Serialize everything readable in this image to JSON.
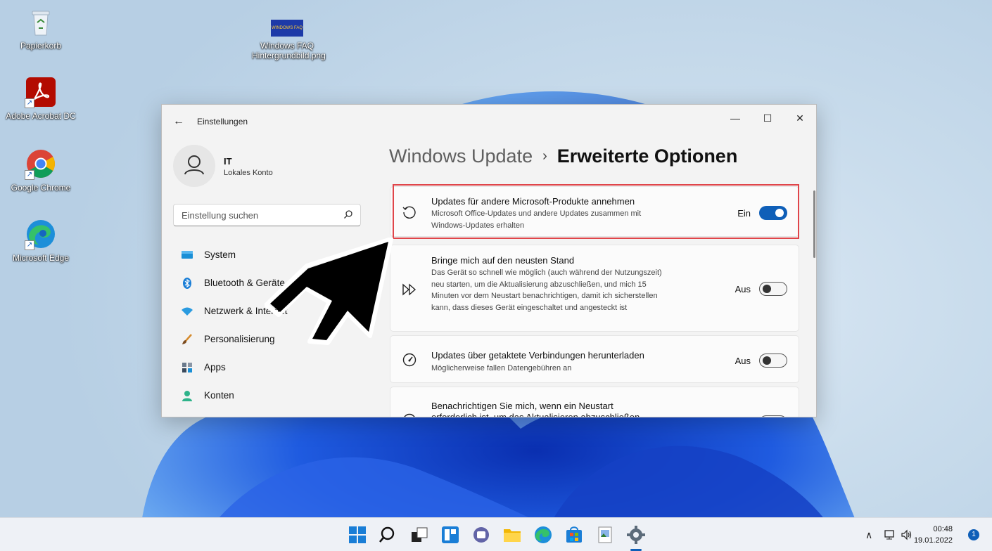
{
  "desktop": {
    "icons": [
      {
        "label": "Papierkorb"
      },
      {
        "label": "Windows FAQ Hintergrundbild.png"
      },
      {
        "label": "Adobe Acrobat DC"
      },
      {
        "label": "Google Chrome"
      },
      {
        "label": "Microsoft Edge"
      }
    ],
    "wallpaper_thumb_text": "WINDOWS FAQ"
  },
  "window": {
    "title": "Einstellungen",
    "user": {
      "name": "IT",
      "account": "Lokales Konto"
    },
    "search": {
      "placeholder": "Einstellung suchen"
    },
    "nav": [
      {
        "label": "System",
        "icon": "monitor-icon"
      },
      {
        "label": "Bluetooth & Geräte",
        "icon": "bluetooth-icon"
      },
      {
        "label": "Netzwerk & Internet",
        "icon": "wifi-icon"
      },
      {
        "label": "Personalisierung",
        "icon": "brush-icon"
      },
      {
        "label": "Apps",
        "icon": "apps-icon"
      },
      {
        "label": "Konten",
        "icon": "person-icon"
      }
    ],
    "breadcrumb": {
      "parent": "Windows Update",
      "separator": "›",
      "current": "Erweiterte Optionen"
    },
    "options": [
      {
        "title": "Updates für andere Microsoft-Produkte annehmen",
        "description": "Microsoft Office-Updates und andere Updates zusammen mit Windows-Updates erhalten",
        "state": "Ein",
        "on": true,
        "icon": "refresh-icon"
      },
      {
        "title": "Bringe mich auf den neusten Stand",
        "description": "Das Gerät so schnell wie möglich (auch während der Nutzungszeit) neu starten, um die Aktualisierung abzuschließen, und mich 15 Minuten vor dem Neustart benachrichtigen, damit ich sicherstellen kann, dass dieses Gerät eingeschaltet und angesteckt ist",
        "state": "Aus",
        "on": false,
        "icon": "fast-forward-icon"
      },
      {
        "title": "Updates über getaktete Verbindungen herunterladen",
        "description": "Möglicherweise fallen Datengebühren an",
        "state": "Aus",
        "on": false,
        "icon": "gauge-icon"
      },
      {
        "title": "Benachrichtigen Sie mich, wenn ein Neustart",
        "description": "erforderlich ist, um das Aktualisieren abzuschließen",
        "state": "",
        "on": false,
        "icon": "bell-icon"
      }
    ]
  },
  "taskbar": {
    "time": "00:48",
    "date": "19.01.2022",
    "notification_count": "1",
    "accent": "#0f5fb8"
  }
}
